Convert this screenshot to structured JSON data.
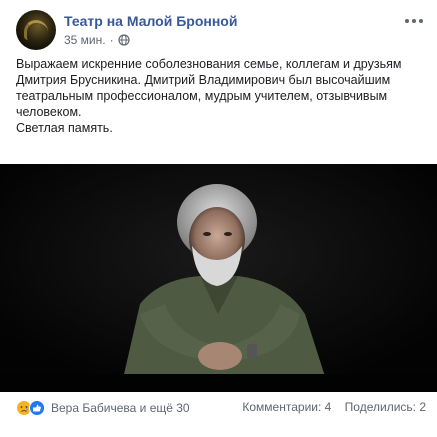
{
  "post": {
    "page_name": "Театр на Малой Бронной",
    "time": "35 мин.",
    "separator": "·",
    "text_lines": [
      "Выражаем искренние соболезнования семье, коллегам и друзьям",
      "Дмитрия Брусникина. Дмитрий Владимирович был высочайшим",
      "театральным профессионалом, мудрым учителем, отзывчивым",
      "человеком.",
      "Светлая память."
    ]
  },
  "icons": {
    "avatar": "theater-logo",
    "privacy": "globe-icon",
    "menu": "more-options-icon",
    "reactions": [
      "sad-reaction-icon",
      "like-reaction-icon"
    ]
  },
  "footer": {
    "reactors": "Вера Бабичева и ещё 30",
    "comments": "Комментарии: 4",
    "shares": "Поделились: 2"
  },
  "colors": {
    "page_name": "#385898",
    "meta_text": "#616770",
    "photo_bg": "#050505",
    "sad": "#f7b125",
    "like": "#2078f4"
  }
}
